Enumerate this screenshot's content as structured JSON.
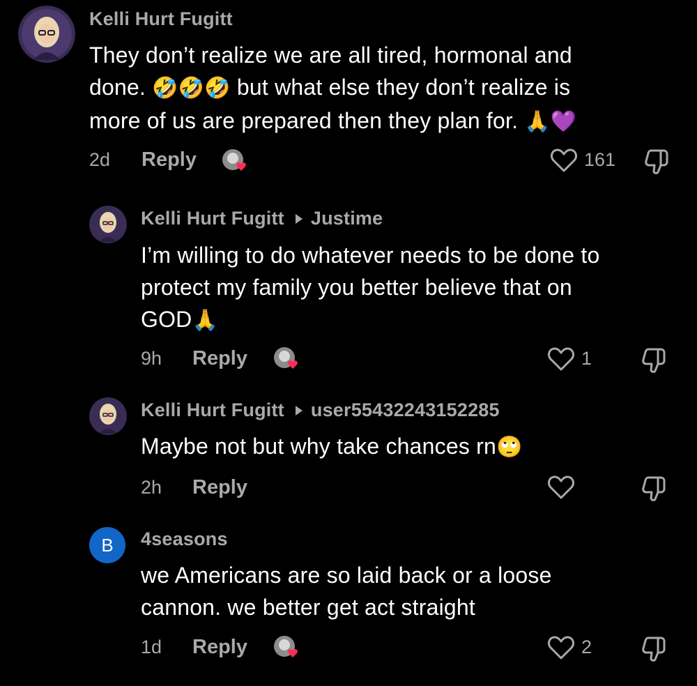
{
  "comments": [
    {
      "author": "Kelli Hurt Fugitt",
      "text_line1": "They don’t realize we are all tired, hormonal and",
      "text_line2a": "done. ",
      "emoji_rofl": "🤣🤣🤣",
      "text_line2b": " but what else they don’t realize is",
      "text_line3": "more of us are prepared then they plan for. ",
      "emoji_end": "🙏💜",
      "time": "2d",
      "reply_label": "Reply",
      "likes": "161"
    },
    {
      "author": "Kelli Hurt Fugitt",
      "reply_to": "Justime",
      "text_line1": "I’m willing to do whatever needs to be done to",
      "text_line2": "protect my family you better believe that on",
      "text_line3": "GOD",
      "emoji_end": "🙏",
      "time": "9h",
      "reply_label": "Reply",
      "likes": "1"
    },
    {
      "author": "Kelli Hurt Fugitt",
      "reply_to": "user55432243152285",
      "text_line1": "Maybe not but why take chances rn",
      "emoji_end": "🙄",
      "time": "2h",
      "reply_label": "Reply",
      "likes": ""
    },
    {
      "author": "4seasons",
      "avatar_letter": "B",
      "text_line1": "we Americans are so laid back or a loose",
      "text_line2": "cannon. we better get act straight",
      "time": "1d",
      "reply_label": "Reply",
      "likes": "2"
    }
  ],
  "colors": {
    "background": "#000000",
    "secondary_text": "#a9a9ad",
    "heart_badge": "#fe2c55",
    "avatar_blue": "#1166c8"
  }
}
